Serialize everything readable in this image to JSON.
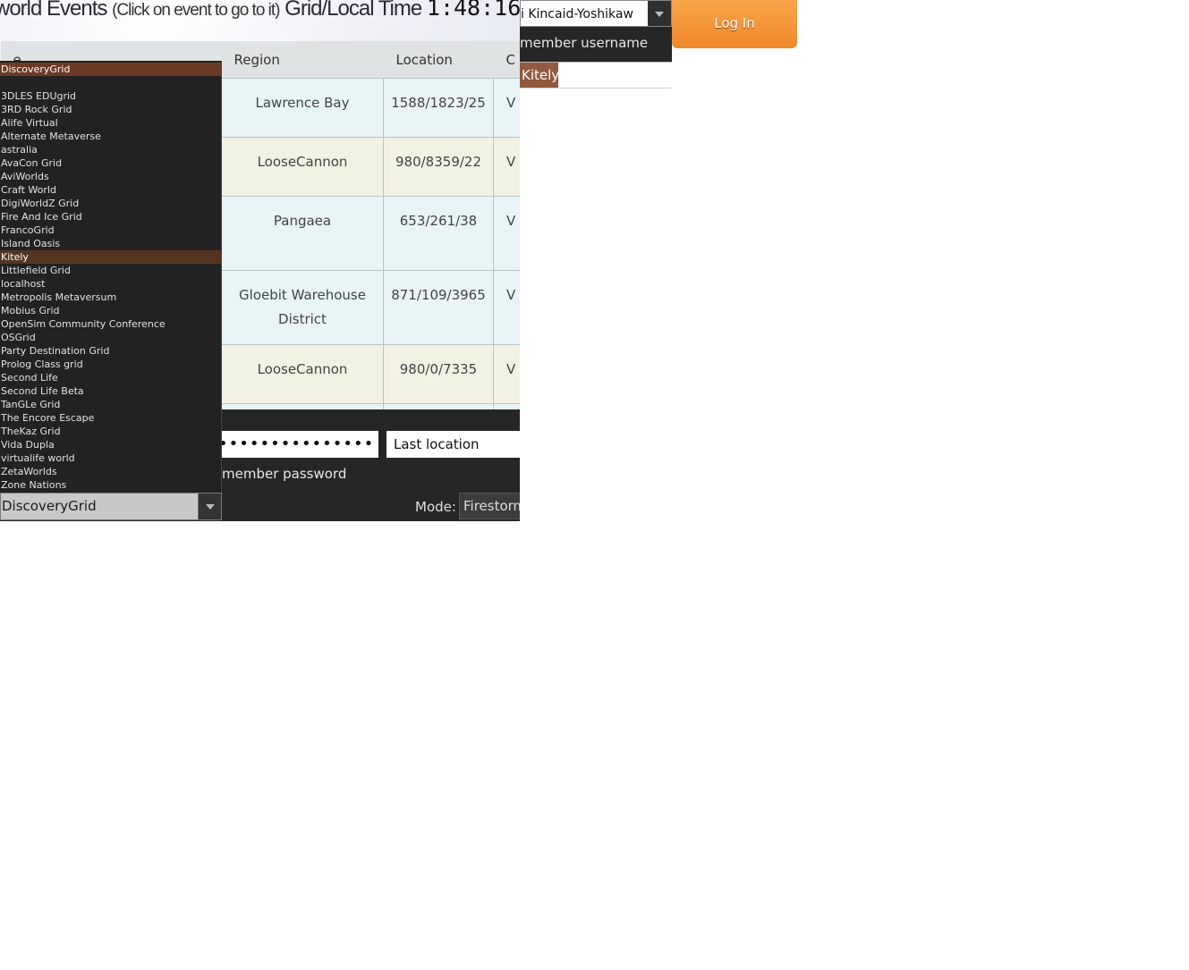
{
  "events": {
    "title_main": "world Events",
    "title_sub": "(Click on event to go to it)",
    "title_time_label": "Grid/Local Time",
    "clock": "1:48:16",
    "columns": [
      "e",
      "Region",
      "Location",
      "C"
    ],
    "rows": [
      {
        "region": "Lawrence Bay",
        "location": "1588/1823/25",
        "cat": "V"
      },
      {
        "region": "LooseCannon",
        "location": "980/8359/22",
        "cat": "V"
      },
      {
        "region": "Pangaea",
        "location": "653/261/38",
        "cat": "V"
      },
      {
        "region": "Gloebit Warehouse District",
        "location": "871/109/3965",
        "cat": "V"
      },
      {
        "region": "LooseCannon",
        "location": "980/0/7335",
        "cat": "V"
      }
    ]
  },
  "login": {
    "username_value": "i Kincaid-Yoshikaw",
    "remember_username": "member username",
    "username_dropdown_item": "Kitely",
    "password_value": "•••••••••••••••",
    "location_value": "Last location",
    "remember_password": "member password",
    "mode_label": "Mode:",
    "mode_value": "Firestorm",
    "login_button": "Log In",
    "accent_color": "#f0882a"
  },
  "grid_selector": {
    "selected": "DiscoveryGrid",
    "hover": "Kitely",
    "options": [
      "DiscoveryGrid",
      "",
      "3DLES EDUgrid",
      "3RD Rock Grid",
      "Alife Virtual",
      "Alternate Metaverse",
      "astralia",
      "AvaCon Grid",
      "AviWorlds",
      "Craft World",
      "DigiWorldZ Grid",
      "Fire And Ice Grid",
      "FrancoGrid",
      "Island Oasis",
      "Kitely",
      "Littlefield Grid",
      "localhost",
      "Metropolis Metaversum",
      "Mobius Grid",
      "OpenSim Community Conference",
      "OSGrid",
      "Party Destination Grid",
      "Prolog Class grid",
      "Second Life",
      "Second Life Beta",
      "TanGLe Grid",
      "The Encore Escape",
      "TheKaz Grid",
      "Vida Dupla",
      "virtualife world",
      "ZetaWorlds",
      "Zone Nations"
    ]
  }
}
